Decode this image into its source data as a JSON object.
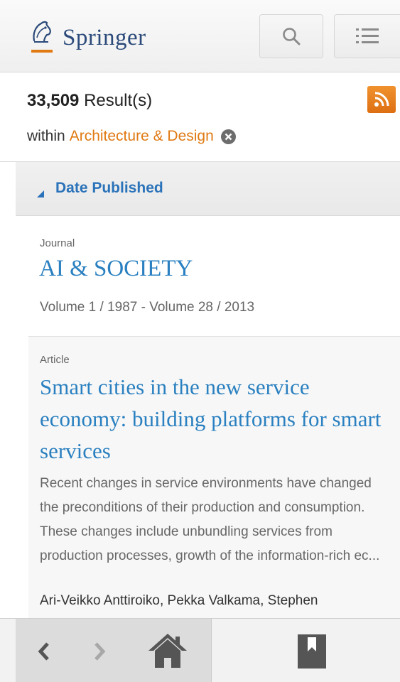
{
  "header": {
    "brand": "Springer",
    "icons": {
      "logo": "springer-horse-icon",
      "search": "search-icon",
      "menu": "menu-list-icon"
    }
  },
  "summary": {
    "count": "33,509",
    "count_label": "Result(s)",
    "within_prefix": "within",
    "within_discipline": "Architecture & Design",
    "icons": {
      "rss": "rss-icon",
      "clear": "close-circle-icon"
    },
    "accent_color": "#e07a13"
  },
  "sort": {
    "label": "Date Published",
    "icon": "sort-triangle-icon"
  },
  "results": [
    {
      "type": "Journal",
      "title": "AI & SOCIETY",
      "meta": "Volume 1 / 1987 - Volume 28 / 2013"
    },
    {
      "type": "Article",
      "title": "Smart cities in the new service economy: building platforms for smart services",
      "snippet": "Recent changes in service environments have changed the preconditions of their production and consumption. These changes include unbundling services from production processes, growth of the information-rich ec...",
      "authors": "Ari-Veikko Anttiroiko, Pekka Valkama, Stephen"
    }
  ],
  "toolbar": {
    "icons": {
      "back": "chevron-left-icon",
      "forward": "chevron-right-icon",
      "home": "home-icon",
      "bookmark": "bookmark-icon"
    }
  },
  "colors": {
    "link_blue": "#2a80c0",
    "brand_blue": "#2b4a7a",
    "rss_orange": "#dd6f12"
  }
}
